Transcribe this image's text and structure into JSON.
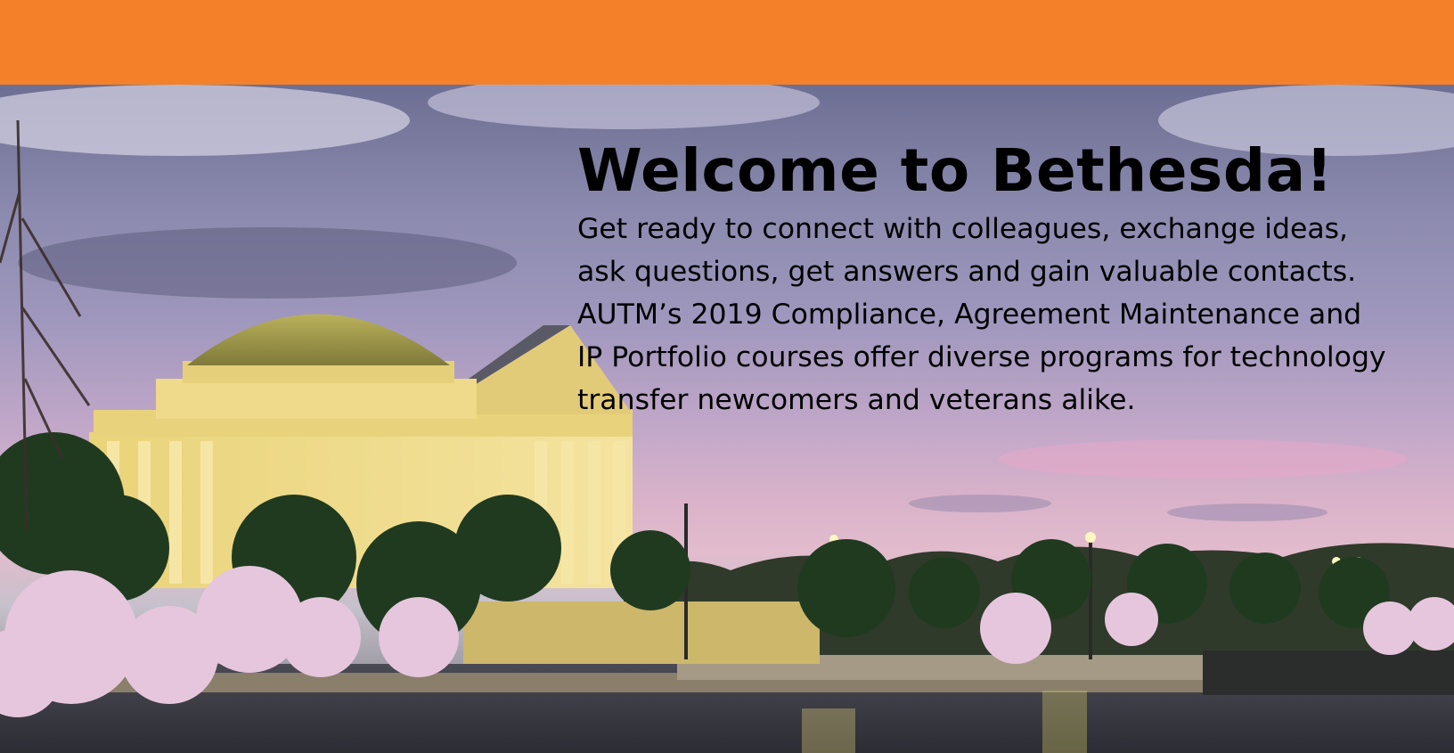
{
  "colors": {
    "header_bar": "#f48129",
    "text": "#000000"
  },
  "hero": {
    "image": "jefferson-memorial-cherry-blossoms-photo",
    "title": "Welcome to Bethesda!",
    "body_lines": [
      "Get ready to connect with colleagues, exchange ideas,",
      "ask questions, get answers and gain valuable contacts.",
      "AUTM’s 2019 Compliance, Agreement Maintenance and",
      "IP Portfolio courses offer diverse programs for technology",
      "transfer newcomers and veterans alike."
    ]
  }
}
